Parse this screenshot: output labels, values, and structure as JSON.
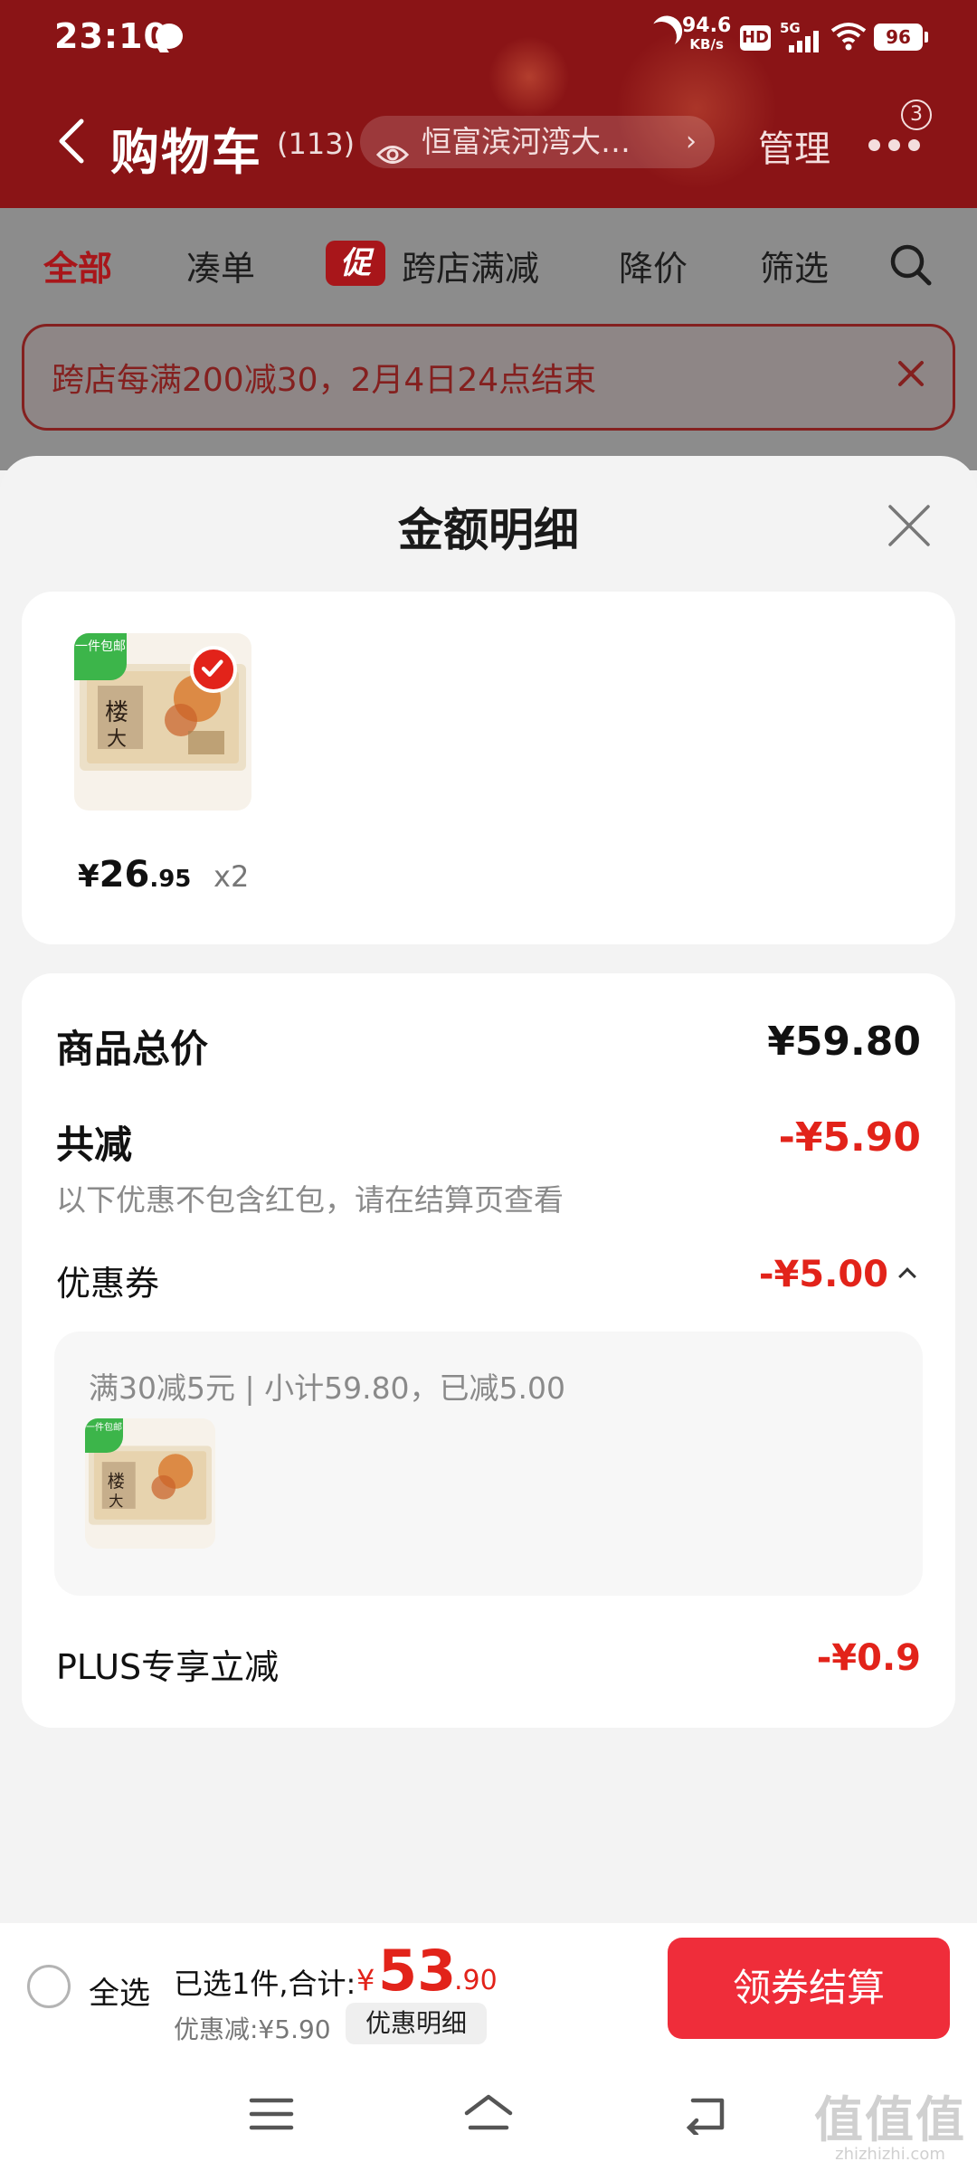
{
  "status_bar": {
    "time": "23:10",
    "net_speed": "94.6",
    "net_unit": "KB/s",
    "hd": "HD",
    "network": "5G",
    "battery": "96"
  },
  "header": {
    "title": "购物车",
    "count": "(113)",
    "address": "恒富滨河湾大…",
    "manage": "管理",
    "more_badge": "3"
  },
  "tabs": [
    "全部",
    "凑单",
    "跨店满减",
    "降价",
    "筛选"
  ],
  "promo_badge": "促",
  "banner": {
    "text": "跨店每满200减30，2月4日24点结束"
  },
  "sheet": {
    "title": "金额明细",
    "product": {
      "tag": "一件包邮",
      "price_symbol": "¥",
      "price_int": "26",
      "price_dec": ".95",
      "qty": "x2"
    },
    "rows": {
      "total_label": "商品总价",
      "total_value": "¥59.80",
      "reduce_label": "共减",
      "reduce_value": "-¥5.90",
      "reduce_note": "以下优惠不包含红包，请在结算页查看",
      "coupon_label": "优惠券",
      "coupon_value": "-¥5.00",
      "coupon_detail": "满30减5元 | 小计59.80，已减5.00",
      "plus_label": "PLUS专享立减",
      "plus_value": "-¥0.9"
    }
  },
  "bottom_bar": {
    "select_all": "全选",
    "summary": "已选1件,合计:",
    "yen": "¥",
    "total_int": "53",
    "total_dec": ".90",
    "discount": "优惠减:¥5.90",
    "detail_button": "优惠明细",
    "checkout_button": "领券结算"
  },
  "watermark": {
    "mark": "值值值",
    "site": "zhizhizhi.com"
  },
  "colors": {
    "header_bg": "#8a1416",
    "accent_red": "#e2231a",
    "checkout_red": "#ef2d3a"
  }
}
